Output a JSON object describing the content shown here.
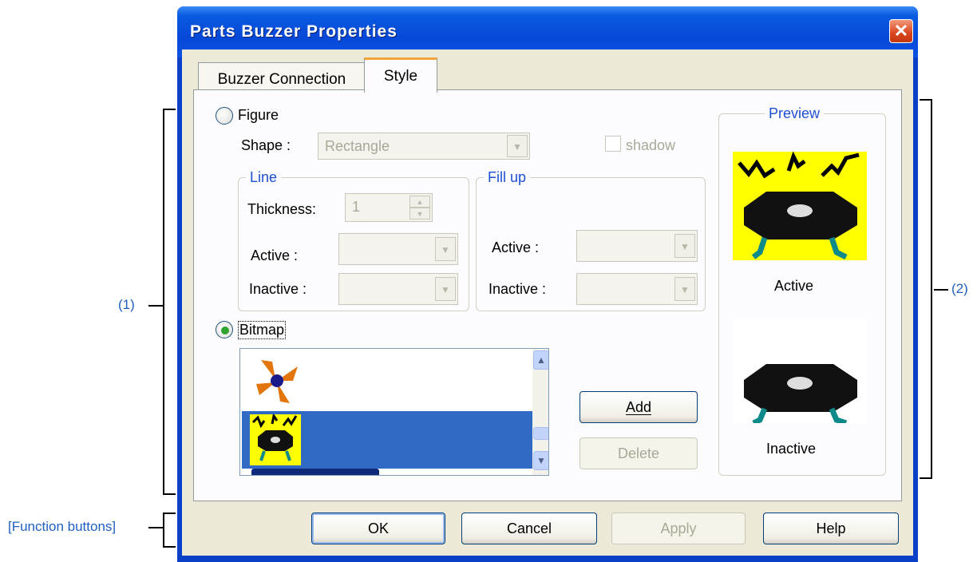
{
  "annotations": {
    "label_1": "(1)",
    "label_2": "(2)",
    "label_function": "[Function buttons]"
  },
  "window": {
    "title": "Parts Buzzer Properties",
    "close_glyph": "✕"
  },
  "tabs": [
    {
      "label": "Buzzer Connection",
      "active": false
    },
    {
      "label": "Style",
      "active": true
    }
  ],
  "style": {
    "figure": {
      "radio_label": "Figure",
      "selected": false,
      "shape_label": "Shape :",
      "shape_value": "Rectangle",
      "shadow_label": "shadow",
      "shadow_checked": false
    },
    "line": {
      "title": "Line",
      "thickness_label": "Thickness:",
      "thickness_value": "1",
      "active_label": "Active :",
      "inactive_label": "Inactive :"
    },
    "fill": {
      "title": "Fill up",
      "active_label": "Active :",
      "inactive_label": "Inactive :"
    },
    "bitmap": {
      "radio_label": "Bitmap",
      "selected": true,
      "list_items": [
        "fan-bitmap",
        "buzzer-bitmap",
        "partial-bitmap"
      ],
      "selected_index": 1
    },
    "buttons": {
      "add": "Add",
      "delete": "Delete"
    },
    "preview": {
      "title": "Preview",
      "active_label": "Active",
      "inactive_label": "Inactive"
    }
  },
  "function_buttons": {
    "ok": "OK",
    "cancel": "Cancel",
    "apply": "Apply",
    "help": "Help"
  },
  "colors": {
    "title_bar": "#0a52e2",
    "selection": "#316ac5",
    "group_title": "#1f4fd2",
    "annotation": "#1f5fbf",
    "preview_active_bg": "#ffff00"
  }
}
